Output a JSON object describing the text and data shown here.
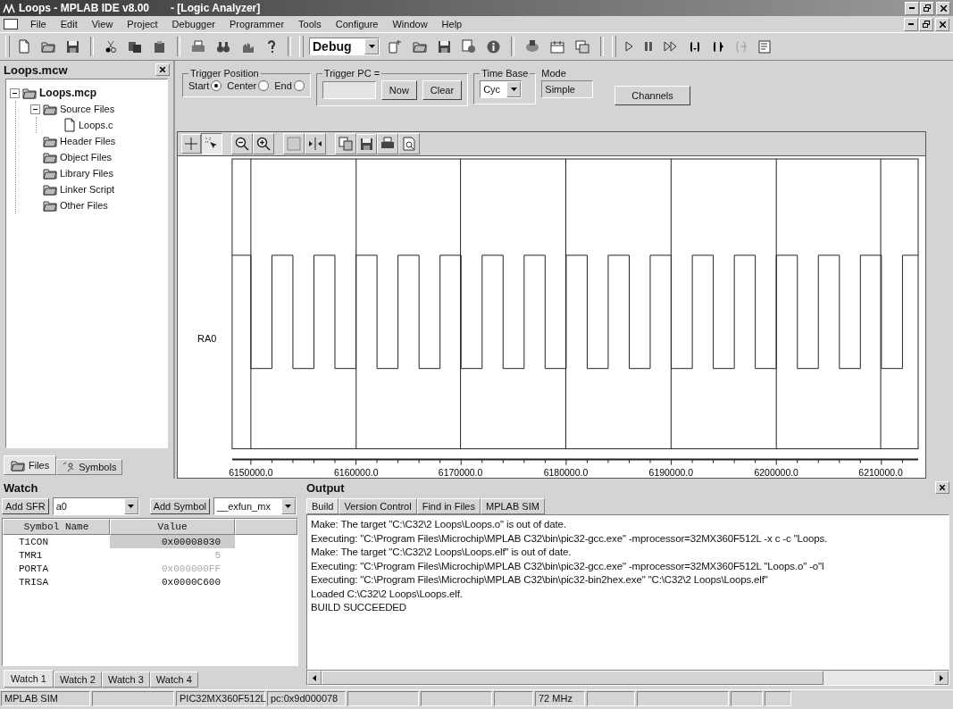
{
  "window": {
    "title": "Loops - MPLAB IDE v8.00",
    "document": "- [Logic Analyzer]"
  },
  "menu": [
    "File",
    "Edit",
    "View",
    "Project",
    "Debugger",
    "Programmer",
    "Tools",
    "Configure",
    "Window",
    "Help"
  ],
  "toolbar": {
    "configuration": "Debug"
  },
  "project": {
    "title": "Loops.mcw",
    "tree": [
      {
        "label": "Loops.mcp",
        "kind": "project",
        "expanded": true,
        "children": [
          {
            "label": "Source Files",
            "kind": "folder",
            "expanded": true,
            "children": [
              {
                "label": "Loops.c",
                "kind": "file"
              }
            ]
          },
          {
            "label": "Header Files",
            "kind": "folder"
          },
          {
            "label": "Object Files",
            "kind": "folder"
          },
          {
            "label": "Library Files",
            "kind": "folder"
          },
          {
            "label": "Linker Script",
            "kind": "folder"
          },
          {
            "label": "Other Files",
            "kind": "folder"
          }
        ]
      }
    ],
    "tabs": [
      {
        "label": "Files",
        "selected": true
      },
      {
        "label": "Symbols",
        "selected": false
      }
    ]
  },
  "analyzer": {
    "trigger_position_label": "Trigger Position",
    "trigger_options": [
      {
        "label": "Start",
        "selected": true
      },
      {
        "label": "Center",
        "selected": false
      },
      {
        "label": "End",
        "selected": false
      }
    ],
    "trigger_pc_label": "Trigger PC =",
    "now_button": "Now",
    "clear_button": "Clear",
    "time_base_label": "Time Base",
    "time_base": "Cyc",
    "mode_label": "Mode",
    "mode": "Simple",
    "channels_button": "Channels",
    "channel": "RA0",
    "x_tick_labels": [
      "6150000.0",
      "6160000.0",
      "6170000.0",
      "6180000.0",
      "6190000.0",
      "6200000.0",
      "6210000.0"
    ]
  },
  "watch": {
    "title": "Watch",
    "add_sfr_button": "Add SFR",
    "sfr": "a0",
    "add_symbol_button": "Add Symbol",
    "symbol": "__exfun_mx",
    "columns": [
      "Symbol Name",
      "Value"
    ],
    "rows": [
      {
        "name": "T1CON",
        "value": "0x00008030",
        "selected": true,
        "changed": false
      },
      {
        "name": "TMR1",
        "value": "5",
        "selected": false,
        "changed": true
      },
      {
        "name": "PORTA",
        "value": "0x000000FF",
        "selected": false,
        "changed": true
      },
      {
        "name": "TRISA",
        "value": "0x0000C600",
        "selected": false,
        "changed": false
      }
    ],
    "tabs": [
      {
        "label": "Watch 1",
        "selected": true
      },
      {
        "label": "Watch 2",
        "selected": false
      },
      {
        "label": "Watch 3",
        "selected": false
      },
      {
        "label": "Watch 4",
        "selected": false
      }
    ]
  },
  "output": {
    "title": "Output",
    "tabs": [
      {
        "label": "Build",
        "selected": true
      },
      {
        "label": "Version Control",
        "selected": false
      },
      {
        "label": "Find in Files",
        "selected": false
      },
      {
        "label": "MPLAB SIM",
        "selected": false
      }
    ],
    "lines": [
      "Make: The target \"C:\\C32\\2 Loops\\Loops.o\" is out of date.",
      "Executing: \"C:\\Program Files\\Microchip\\MPLAB C32\\bin\\pic32-gcc.exe\" -mprocessor=32MX360F512L -x c -c \"Loops.",
      "Make: The target \"C:\\C32\\2 Loops\\Loops.elf\" is out of date.",
      "Executing: \"C:\\Program Files\\Microchip\\MPLAB C32\\bin\\pic32-gcc.exe\" -mprocessor=32MX360F512L \"Loops.o\" -o\"l",
      "Executing: \"C:\\Program Files\\Microchip\\MPLAB C32\\bin\\pic32-bin2hex.exe\" \"C:\\C32\\2 Loops\\Loops.elf\"",
      "Loaded C:\\C32\\2 Loops\\Loops.elf.",
      "BUILD SUCCEEDED"
    ]
  },
  "status_bar": [
    "MPLAB SIM",
    "PIC32MX360F512L",
    "pc:0x9d000078",
    "72 MHz"
  ]
}
